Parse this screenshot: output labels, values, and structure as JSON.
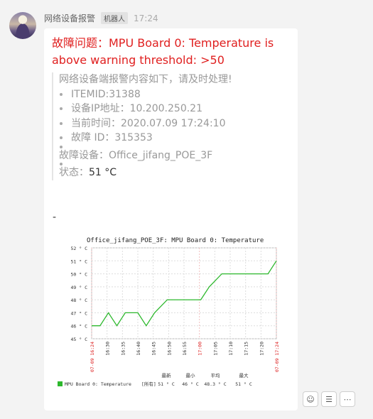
{
  "sender": {
    "name": "网络设备报警",
    "badge": "机器人",
    "time": "17:24"
  },
  "message": {
    "title": "故障问题：MPU Board 0: Temperature is above warning threshold: >50",
    "intro": "网络设备端报警内容如下，请及时处理!",
    "items": [
      "ITEMID:31388",
      "设备IP地址：10.200.250.21",
      "当前时间：2020.07.09 17:24:10",
      "故障 ID：315353"
    ],
    "device_label": "故障设备：",
    "device_value": "Office_jifang_POE_3F",
    "status_label": "状态：",
    "status_value": "51 °C",
    "dash": "-"
  },
  "chart_data": {
    "type": "line",
    "title": "Office_jifang_POE_3F: MPU Board 0: Temperature",
    "ylim": [
      45,
      52
    ],
    "y_ticks": [
      "52 ° C",
      "51 ° C",
      "50 ° C",
      "49 ° C",
      "48 ° C",
      "47 ° C",
      "46 ° C",
      "45 ° C"
    ],
    "x_ticks": [
      "07-09 16:24",
      "16:30",
      "16:35",
      "16:40",
      "16:45",
      "16:50",
      "16:55",
      "17:00",
      "17:05",
      "17:10",
      "17:15",
      "17:20",
      "07-09 17:24"
    ],
    "series": [
      {
        "name": "MPU Board 0: Temperature",
        "color": "#2db82d",
        "points": [
          [
            0,
            46
          ],
          [
            2,
            46
          ],
          [
            4,
            47
          ],
          [
            6,
            46
          ],
          [
            8,
            47
          ],
          [
            11,
            47
          ],
          [
            13,
            46
          ],
          [
            15,
            47
          ],
          [
            18,
            48
          ],
          [
            26,
            48
          ],
          [
            28,
            49
          ],
          [
            31,
            50
          ],
          [
            40,
            50
          ],
          [
            42,
            50
          ],
          [
            44,
            51
          ]
        ]
      }
    ],
    "legend": {
      "headers": [
        "最新",
        "最小",
        "平均",
        "最大"
      ],
      "row_label": "[所有]",
      "values": [
        "51 ° C",
        "46 ° C",
        "48.3 ° C",
        "51 ° C"
      ]
    }
  },
  "actions": [
    "emoji",
    "reply",
    "more"
  ]
}
